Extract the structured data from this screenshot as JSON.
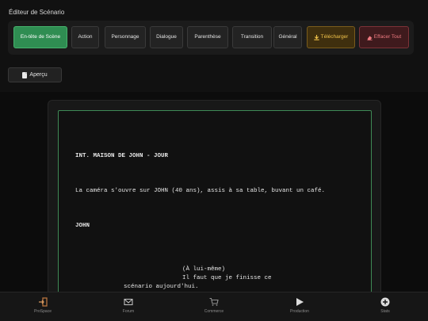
{
  "app": {
    "title": "Éditeur de Scénario"
  },
  "toolbar": {
    "buttons": [
      {
        "label": "En-tête de Scène",
        "state": "active"
      },
      {
        "label": "Action"
      },
      {
        "label": "Personnage"
      },
      {
        "label": "Dialogue"
      },
      {
        "label": "Parenthèse"
      },
      {
        "label": "Transition"
      },
      {
        "label": "Général"
      },
      {
        "label": "Télécharger",
        "icon": "download-icon",
        "color": "#f0c24a"
      },
      {
        "label": "Effacer Tout",
        "icon": "eraser-icon",
        "color": "#ee7a80"
      }
    ]
  },
  "preview": {
    "label": "Aperçu",
    "icon": "document-icon"
  },
  "script": {
    "scene_heading": "INT. MAISON DE JOHN - JOUR",
    "action": "La caméra s'ouvre sur JOHN (40 ans), assis à sa table, buvant un café.",
    "character": "JOHN",
    "parenthetical": "(À lui-même)",
    "dialogue_line1": "Il faut que je finisse ce",
    "dialogue_line2": "scénario aujourd'hui."
  },
  "nav": {
    "items": [
      {
        "label": "ProSpace",
        "icon": "enter-icon"
      },
      {
        "label": "Forum",
        "icon": "mail-icon"
      },
      {
        "label": "Commerce",
        "icon": "cart-icon"
      },
      {
        "label": "Production",
        "icon": "play-icon"
      },
      {
        "label": "Stats",
        "icon": "plus-circle-icon"
      }
    ]
  },
  "colors": {
    "accent": "#2f8d52",
    "download": "#f0c24a",
    "clear": "#ee7a80",
    "page_border": "#3f8a56"
  }
}
